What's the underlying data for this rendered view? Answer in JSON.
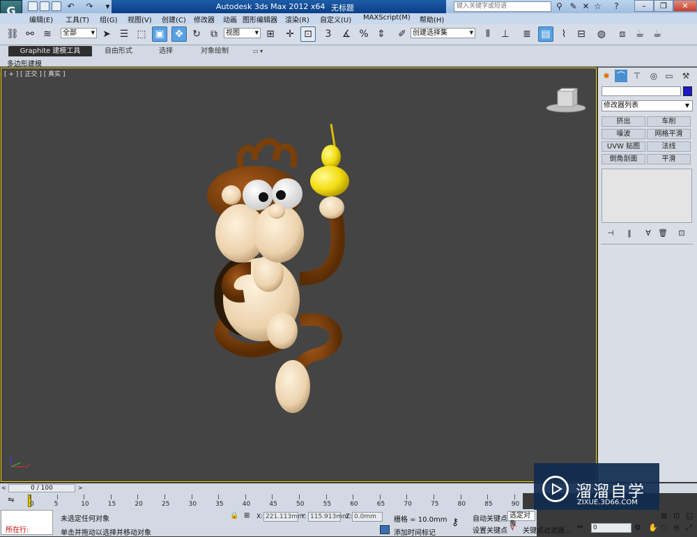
{
  "titlebar": {
    "app_title": "Autodesk 3ds Max  2012 x64",
    "doc_title": "无标题",
    "search_placeholder": "键入关键字或短语",
    "logo_text": "G"
  },
  "menubar": {
    "items": [
      "编辑(E)",
      "工具(T)",
      "组(G)",
      "视图(V)",
      "创建(C)",
      "修改器",
      "动画",
      "图形编辑器",
      "渲染(R)",
      "自定义(U)",
      "MAXScript(M)",
      "帮助(H)"
    ]
  },
  "toolbar": {
    "selection_filter": "全部",
    "reference_coord": "视图",
    "snap_3": "3",
    "named_selection": "创建选择集"
  },
  "ribbon": {
    "tabs": [
      "Graphite 建模工具",
      "自由形式",
      "选择",
      "对象绘制"
    ],
    "subpanel": "多边形建模"
  },
  "viewport": {
    "label": "[ + ] [ 正交 ] [ 真实 ]"
  },
  "command_panel": {
    "modifier_list": "修改器列表",
    "modifier_buttons": [
      "挤出",
      "车削",
      "噪波",
      "网格平滑",
      "UVW 贴图",
      "法线",
      "倒角剖面",
      "平滑"
    ]
  },
  "timeline": {
    "frame_display": "0 / 100",
    "ticks": [
      "0",
      "5",
      "10",
      "15",
      "20",
      "25",
      "30",
      "35",
      "40",
      "45",
      "50",
      "55",
      "60",
      "65",
      "70",
      "75",
      "80",
      "85",
      "90"
    ]
  },
  "status": {
    "running_label": "所在行:",
    "selection_status": "未选定任何对象",
    "prompt": "单击并拖动以选择并移动对象",
    "x_label": "X:",
    "x_value": "221.113mm",
    "y_label": "Y:",
    "y_value": "115.913mm",
    "z_label": "Z:",
    "z_value": "0.0mm",
    "grid": "栅格 = 10.0mm",
    "add_time_tag": "添加时间标记",
    "auto_key": "自动关键点",
    "set_key": "设置关键点",
    "selected_dropdown": "选定对象",
    "key_filters": "关键点过滤器...",
    "frame_spinner": "0"
  },
  "watermark": {
    "title": "溜溜自学",
    "url": "ZIXUE.3D66.COM"
  },
  "colors": {
    "viewport_bg": "#444444",
    "viewport_border": "#f2d000",
    "monkey_brown": "#7a3f0a",
    "monkey_skin": "#f3dcbc",
    "gourd_yellow": "#f5e21a"
  }
}
